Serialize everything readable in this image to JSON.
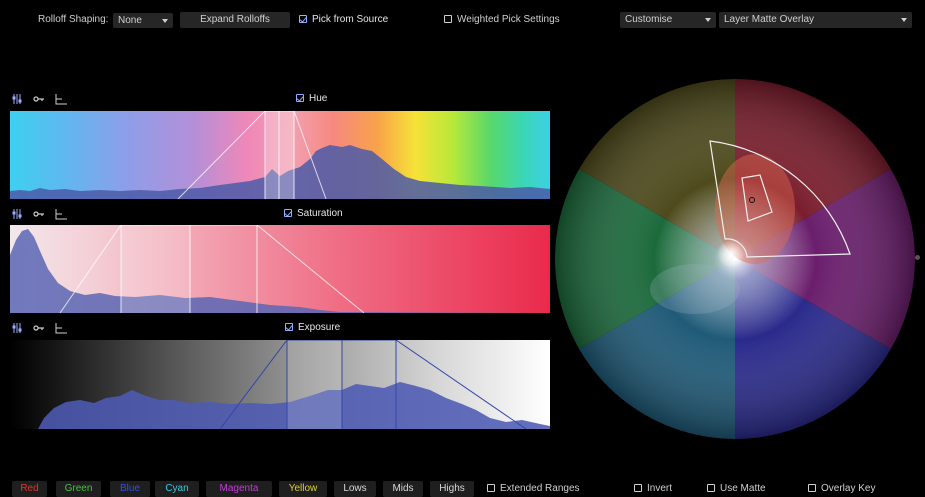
{
  "toolbar": {
    "rolloff_label": "Rolloff Shaping:",
    "rolloff_value": "None",
    "expand_label": "Expand Rolloffs",
    "pick_from_source": {
      "label": "Pick from Source",
      "checked": true
    },
    "weighted_pick": {
      "label": "Weighted Pick Settings",
      "checked": false
    },
    "customise_value": "Customise",
    "overlay_value": "Layer Matte Overlay"
  },
  "panels": [
    {
      "title": "Hue",
      "checked": true
    },
    {
      "title": "Saturation",
      "checked": true
    },
    {
      "title": "Exposure",
      "checked": true
    }
  ],
  "bottom": {
    "buttons": [
      {
        "label": "Red",
        "color": "#e0342c"
      },
      {
        "label": "Green",
        "color": "#44c43c"
      },
      {
        "label": "Blue",
        "color": "#3450e6"
      },
      {
        "label": "Cyan",
        "color": "#2ec8dc"
      },
      {
        "label": "Magenta",
        "color": "#c43cd8"
      },
      {
        "label": "Yellow",
        "color": "#d8d234"
      },
      {
        "label": "Lows",
        "color": "#d8d8d8"
      },
      {
        "label": "Mids",
        "color": "#d8d8d8"
      },
      {
        "label": "Highs",
        "color": "#d8d8d8"
      }
    ],
    "extended_ranges": {
      "label": "Extended Ranges",
      "checked": false
    },
    "invert": {
      "label": "Invert",
      "checked": false
    },
    "use_matte": {
      "label": "Use Matte",
      "checked": false
    },
    "overlay_key": {
      "label": "Overlay Key",
      "checked": false
    }
  },
  "icons": [
    "sliders-icon",
    "key-icon",
    "axis-icon",
    "chevron-down-icon",
    "checkbox-icon"
  ]
}
